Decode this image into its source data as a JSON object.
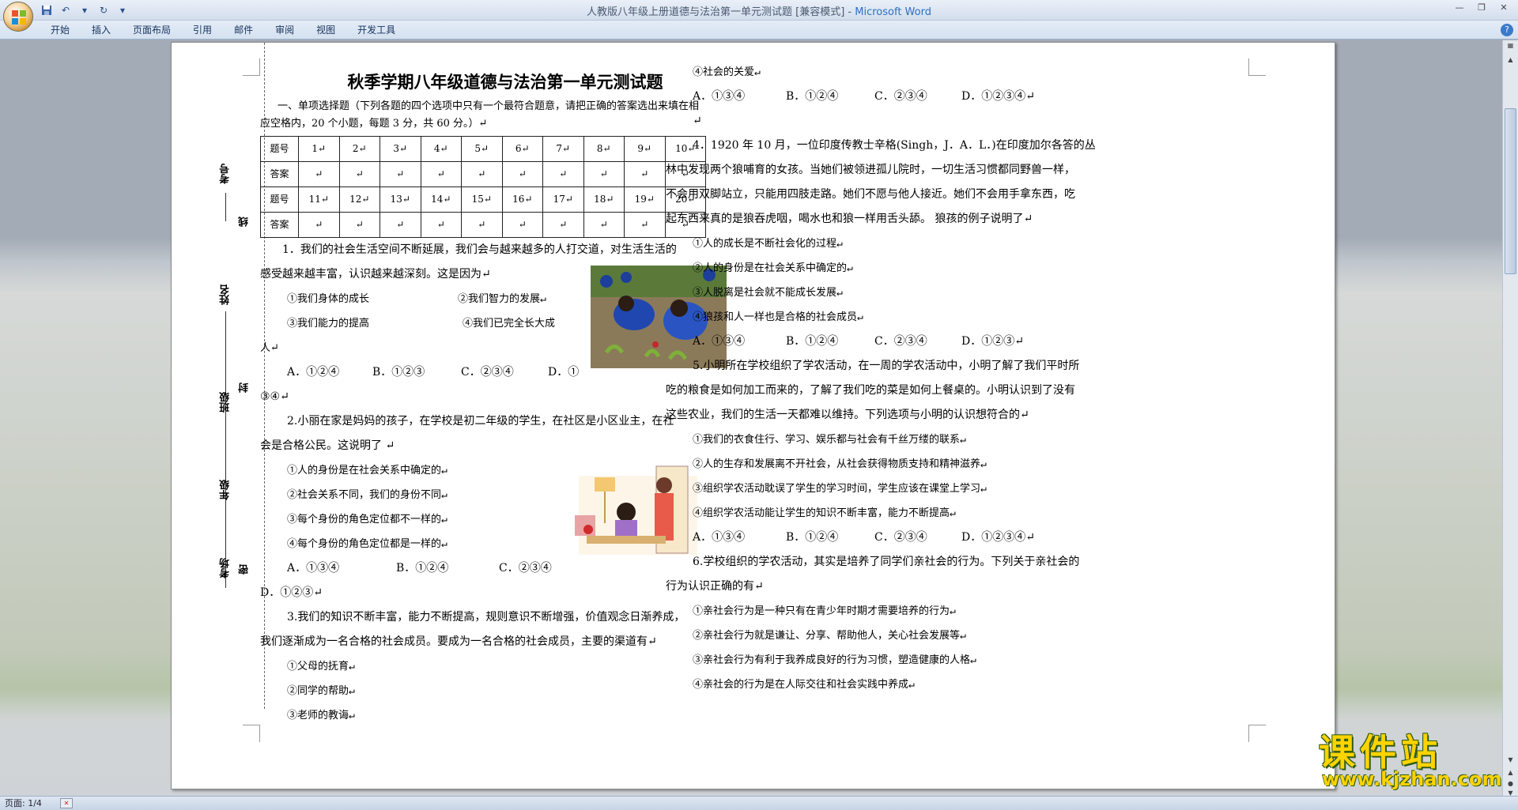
{
  "window": {
    "title": "人教版八年级上册道德与法治第一单元测试题 [兼容模式] - ",
    "app_name": "Microsoft Word"
  },
  "ribbon": {
    "tabs": [
      "开始",
      "插入",
      "页面布局",
      "引用",
      "邮件",
      "审阅",
      "视图",
      "开发工具"
    ]
  },
  "statusbar": {
    "page": "页面: 1/4"
  },
  "binding": {
    "labels": [
      "考号",
      "线",
      "姓名",
      "封",
      "班级",
      "年级",
      "考场",
      "密"
    ]
  },
  "doc": {
    "title": "秋季学期八年级道德与法治第一单元测试题",
    "section1": "一、单项选择题（下列各题的四个选项中只有一个最符合题意，请把正确的答案选出来填在相",
    "section1b": "应空格内，20 个小题，每题 3 分，共 60 分。）↵",
    "table": {
      "row1_label": "题号",
      "row2_label": "答案",
      "row3_label": "题号",
      "row4_label": "答案",
      "nums1": [
        "1↵",
        "2↵",
        "3↵",
        "4↵",
        "5↵",
        "6↵",
        "7↵",
        "8↵",
        "9↵",
        "10↵"
      ],
      "nums2": [
        "11↵",
        "12↵",
        "13↵",
        "14↵",
        "15↵",
        "16↵",
        "17↵",
        "18↵",
        "19↵",
        "20↵"
      ],
      "empty": "↵"
    },
    "q1": {
      "l1": "1．我们的社会生活空间不断延展，我们会与越来越多的人打交道，对生活生活的",
      "l2": "感受越来越丰富，认识越来越深刻。这是因为↵",
      "o1": "①我们身体的成长",
      "o2": "②我们智力的发展↵",
      "o3": "③我们能力的提高",
      "o4": "④我们已完全长大成",
      "o4b": "人↵",
      "a": "A．①②④",
      "b": "B．①②③",
      "c": "C．②③④",
      "d": "D．①",
      "d2": "③④↵"
    },
    "q2": {
      "l1": "2.小丽在家是妈妈的孩子，在学校是初二年级的学生，在社区是小区业主，在社",
      "l2": "会是合格公民。这说明了 ↵",
      "o1": "①人的身份是在社会关系中确定的↵",
      "o2": "②社会关系不同，我们的身份不同↵",
      "o3": "③每个身份的角色定位都不一样的↵",
      "o4": "④每个身份的角色定位都是一样的↵",
      "a": "A．①③④",
      "b": "B．①②④",
      "c": "C．②③④",
      "d": "D．①②③↵"
    },
    "q3": {
      "l1": "3.我们的知识不断丰富，能力不断提高，规则意识不断增强，价值观念日渐养成，",
      "l2": "我们逐渐成为一名合格的社会成员。要成为一名合格的社会成员，主要的渠道有↵",
      "o1": "①父母的抚育↵",
      "o2": "②同学的帮助↵",
      "o3": "③老师的教诲↵",
      "o4": "④社会的关爱↵",
      "a": "A．①③④",
      "b": "B．①②④",
      "c": "C．②③④",
      "d": "D．①②③④↵",
      "blank": "↵"
    },
    "q4": {
      "l1": "4．1920 年 10 月，一位印度传教士辛格(Singh，J．A．L．)在印度加尔各答的丛",
      "l2": "林中发现两个狼哺育的女孩。当她们被领进孤儿院时，一切生活习惯都同野兽一样，",
      "l3": "不会用双脚站立，只能用四肢走路。她们不愿与他人接近。她们不会用手拿东西，吃",
      "l4": "起东西来真的是狼吞虎咽，喝水也和狼一样用舌头舔。 狼孩的例子说明了↵",
      "o1": "①人的成长是不断社会化的过程↵",
      "o2": "②人的身份是在社会关系中确定的↵",
      "o3": "③人脱离是社会就不能成长发展↵",
      "o4": "④狼孩和人一样也是合格的社会成员↵",
      "a": "A．①③④",
      "b": "B．①②④",
      "c": "C．②③④",
      "d": "D．①②③↵"
    },
    "q5": {
      "l1": "5.小明所在学校组织了学农活动，在一周的学农活动中，小明了解了我们平时所",
      "l2": "吃的粮食是如何加工而来的，了解了我们吃的菜是如何上餐桌的。小明认识到了没有",
      "l3": "这些农业，我们的生活一天都难以维持。下列选项与小明的认识想符合的↵",
      "o1": "①我们的衣食住行、学习、娱乐都与社会有千丝万缕的联系↵",
      "o2": "②人的生存和发展离不开社会，从社会获得物质支持和精神滋养↵",
      "o3": "③组织学农活动耽误了学生的学习时间，学生应该在课堂上学习↵",
      "o4": "④组织学农活动能让学生的知识不断丰富，能力不断提高↵",
      "a": "A．①③④",
      "b": "B．①②④",
      "c": "C．②③④",
      "d": "D．①②③④↵"
    },
    "q6": {
      "l1": "6.学校组织的学农活动，其实是培养了同学们亲社会的行为。下列关于亲社会的",
      "l2": "行为认识正确的有↵",
      "o1": "①亲社会行为是一种只有在青少年时期才需要培养的行为↵",
      "o2": "②亲社会行为就是谦让、分享、帮助他人，关心社会发展等↵",
      "o3": "③亲社会行为有利于我养成良好的行为习惯，塑造健康的人格↵",
      "o4": "④亲社会的行为是在人际交往和社会实践中养成↵"
    }
  },
  "watermark": {
    "cn": "课件站",
    "url": "www.kjzhan.com"
  }
}
